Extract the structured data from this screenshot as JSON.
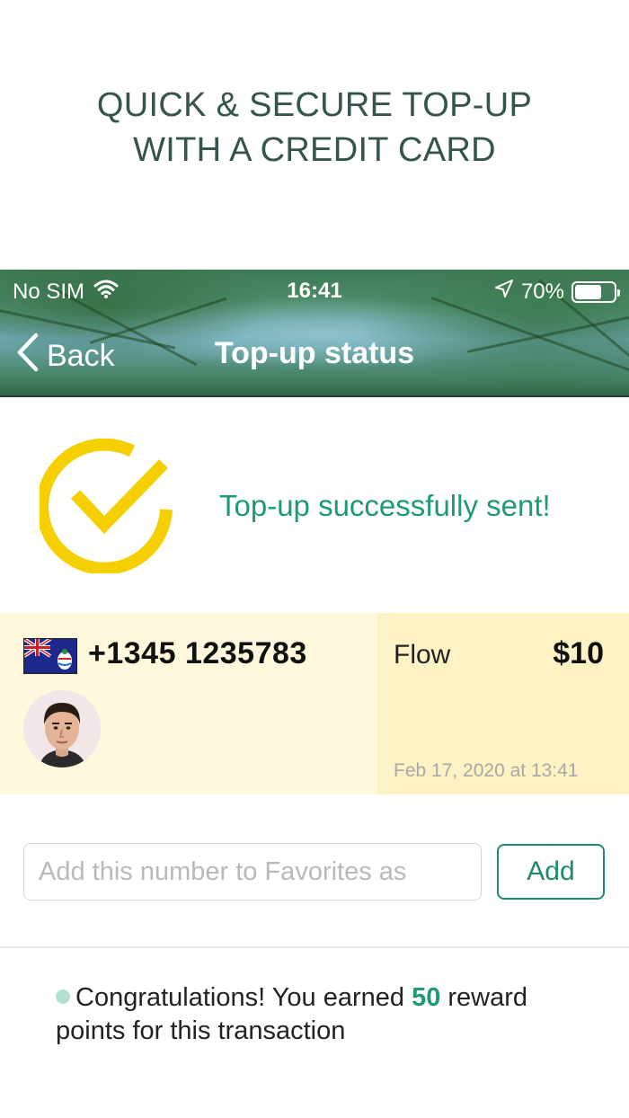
{
  "promo": {
    "line1": "QUICK & SECURE TOP-UP",
    "line2": "WITH A CREDIT CARD"
  },
  "status_bar": {
    "carrier": "No SIM",
    "time": "16:41",
    "battery": "70%",
    "battery_level": 0.7
  },
  "nav": {
    "back_label": "Back",
    "title": "Top-up status"
  },
  "success": {
    "message": "Top-up successfully sent!",
    "icon": "check-circle-icon",
    "icon_color": "#f5cf00"
  },
  "recipient": {
    "flag": "cayman-islands-flag-icon",
    "phone": "+1345 1235783",
    "operator": "Flow",
    "amount": "$10",
    "date": "Feb 17, 2020 at 13:41"
  },
  "favorites": {
    "placeholder": "Add this number to Favorites as",
    "value": "",
    "add_label": "Add"
  },
  "reward": {
    "text_before": "Congratulations! You earned ",
    "points": "50",
    "text_after": " reward points for this transaction"
  },
  "colors": {
    "accent_green": "#1f9a73",
    "promo_text": "#35544e",
    "card_left_bg": "#fff8dc",
    "card_right_bg": "#fdf2c3"
  }
}
